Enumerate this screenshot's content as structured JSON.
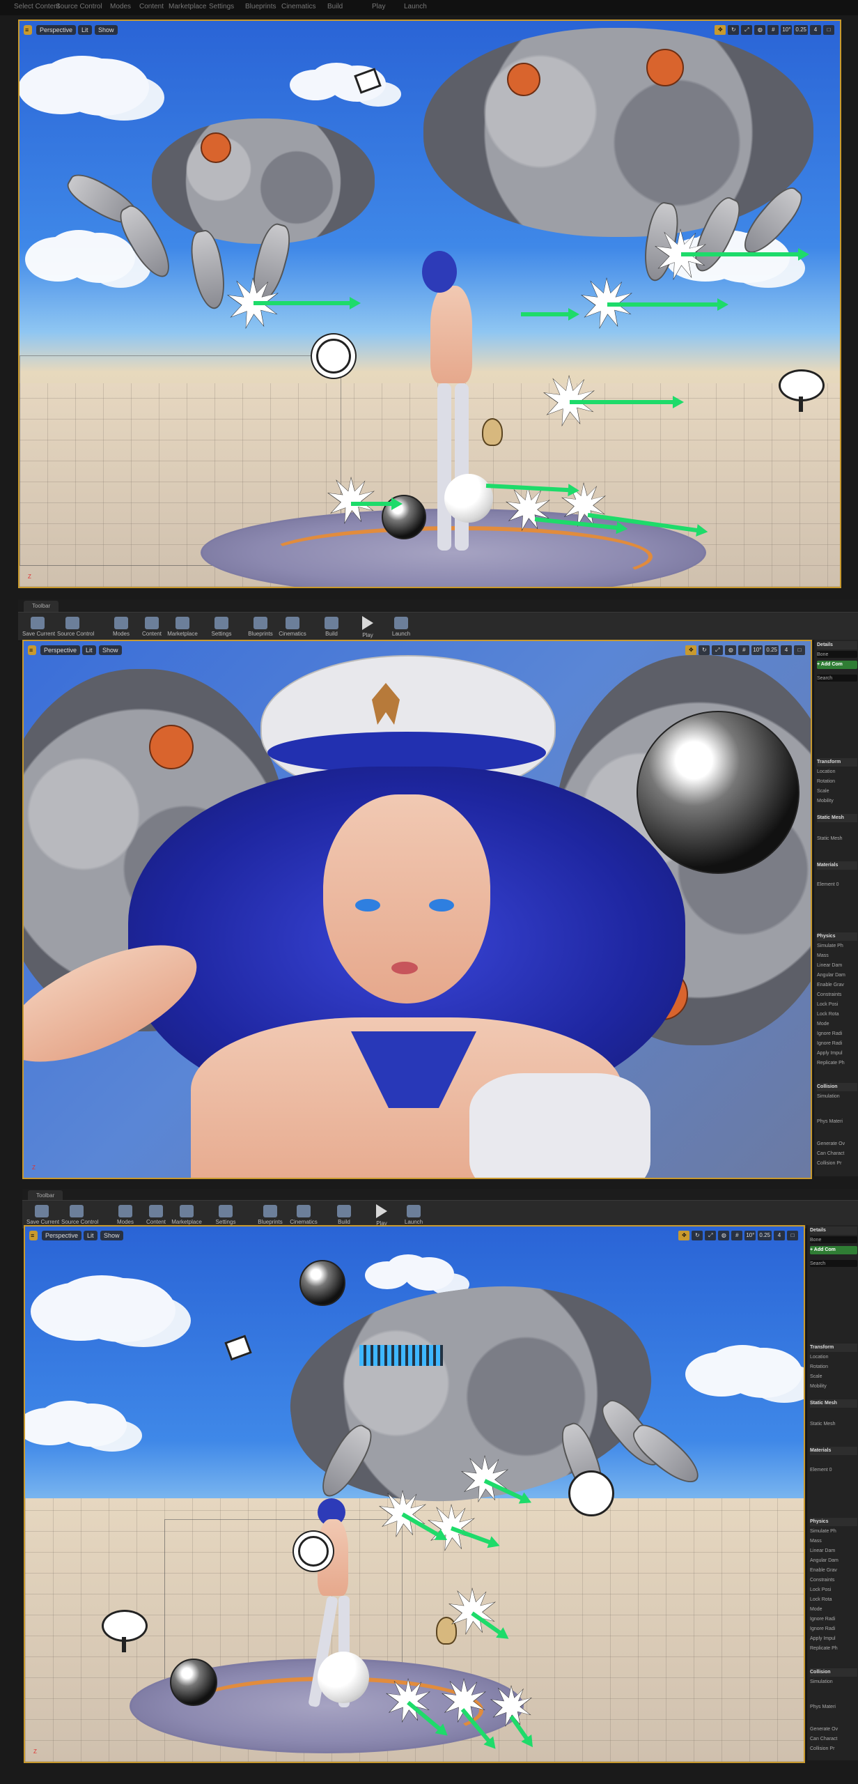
{
  "menu": {
    "items": [
      "Select Content",
      "Source Control",
      "Modes",
      "Content",
      "Marketplace",
      "Settings",
      "Blueprints",
      "Cinematics",
      "Build",
      "Play",
      "Launch"
    ]
  },
  "viewport_bar": {
    "perspective": "Perspective",
    "lit": "Lit",
    "show": "Show",
    "fov": "10°",
    "speed": "0.25",
    "cam": "4"
  },
  "toolbar": {
    "tab_label": "Toolbar",
    "buttons": [
      {
        "label": "Save Current",
        "icon": "save-icon"
      },
      {
        "label": "Source Control",
        "icon": "source-control-icon"
      },
      {
        "label": "Modes",
        "icon": "modes-icon"
      },
      {
        "label": "Content",
        "icon": "content-icon"
      },
      {
        "label": "Marketplace",
        "icon": "marketplace-icon"
      },
      {
        "label": "Settings",
        "icon": "settings-icon"
      },
      {
        "label": "Blueprints",
        "icon": "blueprints-icon"
      },
      {
        "label": "Cinematics",
        "icon": "cinematics-icon"
      },
      {
        "label": "Build",
        "icon": "build-icon"
      },
      {
        "label": "Play",
        "icon": "play-icon"
      },
      {
        "label": "Launch",
        "icon": "launch-icon"
      }
    ]
  },
  "details": {
    "title": "Details",
    "actor": "Bone",
    "add_component": "+ Add Com",
    "search": "Search",
    "sections": [
      "Transform",
      "Location",
      "Rotation",
      "Scale",
      "Mobility",
      "Static Mesh",
      "Static Mesh",
      "Materials",
      "Element 0",
      "Physics",
      "Simulate Ph",
      "Mass",
      "Linear Dam",
      "Angular Dam",
      "Enable Grav",
      "Constraints",
      "Lock Posi",
      "Lock Rota",
      "Mode",
      "Ignore Radi",
      "Ignore Radi",
      "Apply Impul",
      "Replicate Ph",
      "Collision",
      "Simulation",
      "Phys Materi",
      "Generate Ov",
      "Can Charact",
      "Collision Pr"
    ]
  },
  "axis_label": "Z"
}
